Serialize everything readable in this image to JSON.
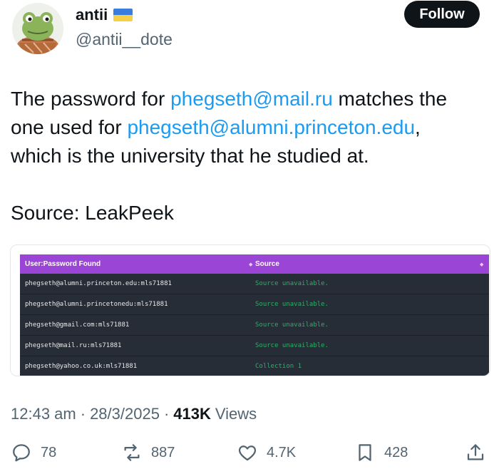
{
  "author": {
    "name": "antii",
    "handle": "@antii__dote",
    "flag_icon": "ukraine-flag-icon"
  },
  "follow_label": "Follow",
  "tweet": {
    "line1_pre": "The password for ",
    "line1_link": "phegseth@mail.ru",
    "line1_post": " matches the",
    "line2_pre": "one used for ",
    "line2_link": "phegseth@alumni.princeton.edu",
    "line2_post": ",",
    "line3": "which is the university that he studied at.",
    "source": "Source: LeakPeek"
  },
  "leak_table": {
    "col_user": "User:Password Found",
    "col_source": "Source",
    "rows": [
      {
        "user": "phegseth@alumni.princeton.edu:mls71881",
        "source": "Source unavailable."
      },
      {
        "user": "phegseth@alumni.princetonedu:mls71881",
        "source": "Source unavailable."
      },
      {
        "user": "phegseth@gmail.com:mls71881",
        "source": "Source unavailable."
      },
      {
        "user": "phegseth@mail.ru:mls71881",
        "source": "Source unavailable."
      },
      {
        "user": "phegseth@yahoo.co.uk:mls71881",
        "source": "Collection 1"
      }
    ]
  },
  "meta": {
    "time": "12:43 am",
    "sep1": "·",
    "date": "28/3/2025",
    "sep2": "·",
    "views_count": "413K",
    "views_label": "Views"
  },
  "actions": {
    "replies": "78",
    "reposts": "887",
    "likes": "4.7K",
    "bookmarks": "428"
  },
  "colors": {
    "link": "#1d9bf0",
    "table_header": "#9b45d6",
    "table_bg": "#262d36",
    "source_text": "#2fae6a"
  }
}
